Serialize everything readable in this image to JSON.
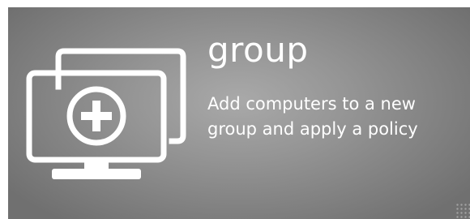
{
  "tile": {
    "title": "group",
    "description": "Add computers to a new group and apply a policy",
    "icon": "add-computer-group-icon",
    "background_color": "#8f8f8f",
    "text_color": "#ffffff"
  }
}
